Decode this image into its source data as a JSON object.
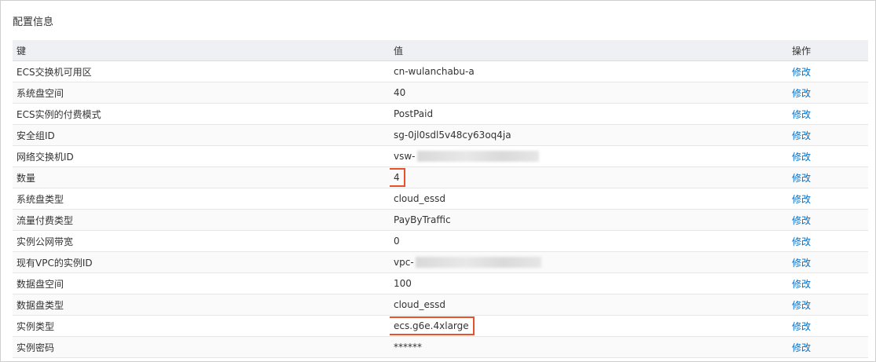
{
  "panel": {
    "title": "配置信息"
  },
  "table": {
    "headers": {
      "key": "键",
      "value": "值",
      "action": "操作"
    },
    "rows": [
      {
        "key": "ECS交换机可用区",
        "value": "cn-wulanchabu-a",
        "action": "修改"
      },
      {
        "key": "系统盘空间",
        "value": "40",
        "action": "修改"
      },
      {
        "key": "ECS实例的付费模式",
        "value": "PostPaid",
        "action": "修改"
      },
      {
        "key": "安全组ID",
        "value": "sg-0jl0sdl5v48cy63oq4ja",
        "action": "修改"
      },
      {
        "key": "网络交换机ID",
        "value": "vsw-",
        "masked": true,
        "action": "修改"
      },
      {
        "key": "数量",
        "value": "4",
        "highlighted": true,
        "action": "修改"
      },
      {
        "key": "系统盘类型",
        "value": "cloud_essd",
        "action": "修改"
      },
      {
        "key": "流量付费类型",
        "value": "PayByTraffic",
        "action": "修改"
      },
      {
        "key": "实例公网带宽",
        "value": "0",
        "action": "修改"
      },
      {
        "key": "现有VPC的实例ID",
        "value": "vpc-",
        "masked": true,
        "action": "修改"
      },
      {
        "key": "数据盘空间",
        "value": "100",
        "action": "修改"
      },
      {
        "key": "数据盘类型",
        "value": "cloud_essd",
        "action": "修改"
      },
      {
        "key": "实例类型",
        "value": "ecs.g6e.4xlarge",
        "highlighted": true,
        "action": "修改"
      },
      {
        "key": "实例密码",
        "value": "******",
        "action": "修改"
      }
    ]
  },
  "colors": {
    "link": "#0070cc",
    "highlight": "#e8522a",
    "header_bg": "#eef0f4"
  }
}
